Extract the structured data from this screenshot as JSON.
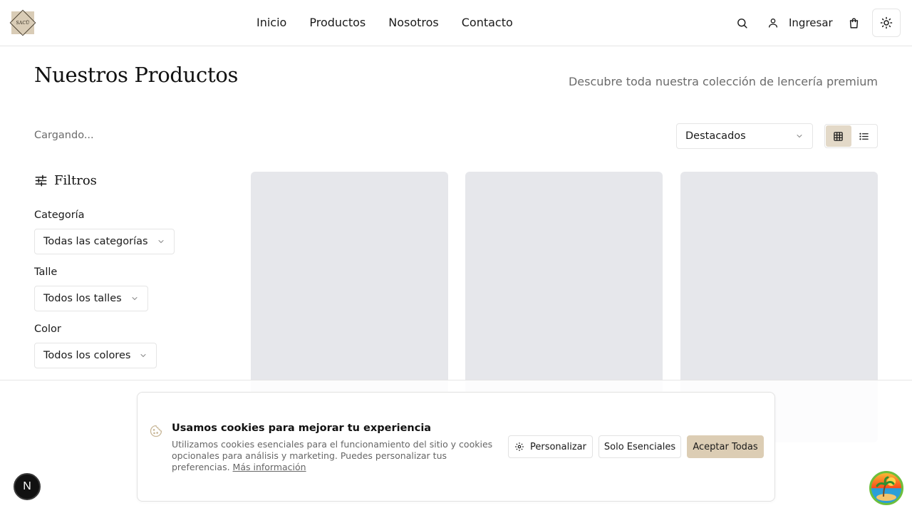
{
  "header": {
    "logo_text": "SACŪ",
    "nav": [
      "Inicio",
      "Productos",
      "Nosotros",
      "Contacto"
    ],
    "login_label": "Ingresar",
    "icons": [
      "search-icon",
      "user-icon",
      "cart-icon",
      "sun-icon"
    ]
  },
  "page": {
    "title": "Nuestros Productos",
    "subtitle": "Descubre toda nuestra colección de lencería premium"
  },
  "toolbar": {
    "status": "Cargando...",
    "sort_value": "Destacados",
    "view_modes": [
      "grid",
      "list"
    ],
    "active_view": "grid"
  },
  "filters": {
    "title": "Filtros",
    "category": {
      "label": "Categoría",
      "value": "Todas las categorías"
    },
    "size": {
      "label": "Talle",
      "value": "Todos los talles"
    },
    "color": {
      "label": "Color",
      "value": "Todos los colores"
    }
  },
  "products": {
    "skeleton_count": 3
  },
  "cookie": {
    "title": "Usamos cookies para mejorar tu experiencia",
    "text": "Utilizamos cookies esenciales para el funcionamiento del sitio y cookies opcionales para análisis y marketing. Puedes personalizar tus preferencias.",
    "link": "Más información",
    "btn_customize": "Personalizar",
    "btn_essential": "Solo Esenciales",
    "btn_accept": "Aceptar Todas"
  },
  "floating": {
    "dev_badge": "N"
  },
  "colors": {
    "accent": "#dccdb4",
    "active_toggle": "#e3d9c8",
    "skeleton": "#e6e7eb",
    "border": "#e5e5e5",
    "muted_text": "#6b6b6b"
  }
}
